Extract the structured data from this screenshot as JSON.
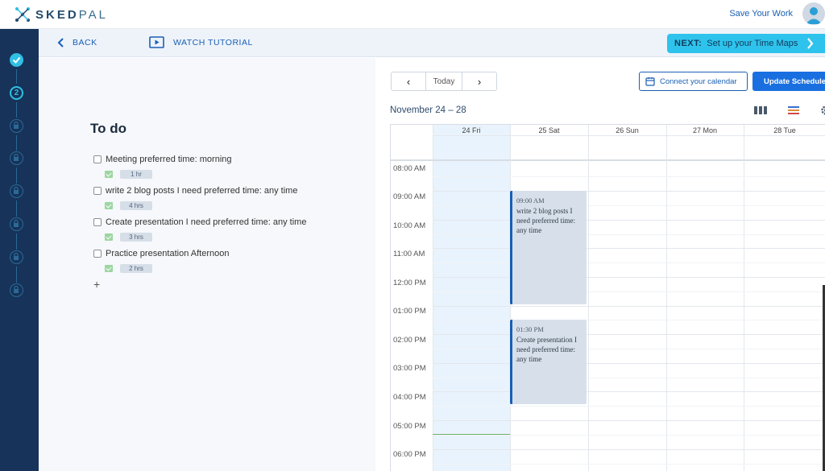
{
  "app": {
    "brand_bold": "SKED",
    "brand_thin": "PAL",
    "save_label": "Save Your Work"
  },
  "subheader": {
    "back_label": "BACK",
    "tutorial_label": "WATCH TUTORIAL",
    "next_prefix": "NEXT:",
    "next_label": "Set up your Time Maps"
  },
  "sidebar": {
    "active_step": "2"
  },
  "todo": {
    "title": "To do",
    "add_symbol": "+",
    "tasks": [
      {
        "label": "Meeting  preferred time:  morning",
        "duration": "1 hr"
      },
      {
        "label": "write 2 blog posts I need   preferred time: any time",
        "duration": "4 hrs"
      },
      {
        "label": "Create presentation I need   preferred time: any time",
        "duration": "3 hrs"
      },
      {
        "label": "Practice presentation   Afternoon",
        "duration": "2 hrs"
      }
    ]
  },
  "calendar": {
    "prev_arrow": "‹",
    "next_arrow": "›",
    "today_label": "Today",
    "connect_label": "Connect your calendar",
    "update_label": "Update Schedule",
    "date_range": "November 24 – 28",
    "days": [
      "24 Fri",
      "25 Sat",
      "26 Sun",
      "27 Mon",
      "28 Tue"
    ],
    "times": [
      "08:00 AM",
      "09:00 AM",
      "10:00 AM",
      "11:00 AM",
      "12:00 PM",
      "01:00 PM",
      "02:00 PM",
      "03:00 PM",
      "04:00 PM",
      "05:00 PM",
      "06:00 PM"
    ],
    "events": [
      {
        "time": "09:00 AM",
        "title": "write 2 blog posts I need preferred time: any time"
      },
      {
        "time": "01:30 PM",
        "title": "Create presentation I need preferred time: any time"
      }
    ]
  },
  "colors": {
    "accent": "#1a5fb4",
    "next_banner": "#2ec3ec",
    "sidebar": "#17335a",
    "today_column": "#e9f3fd"
  }
}
